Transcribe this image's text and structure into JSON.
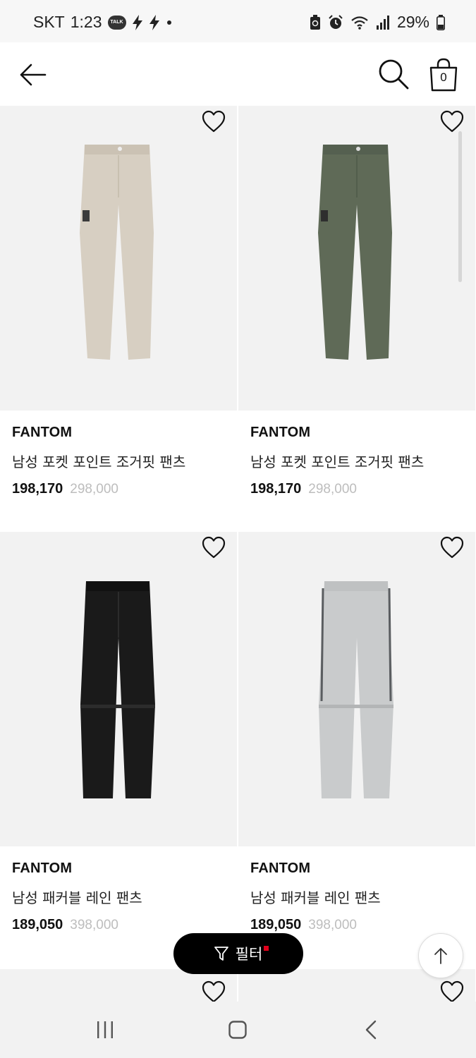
{
  "status_bar": {
    "carrier": "SKT",
    "time": "1:23",
    "talk_badge": "TALK",
    "battery_percent": "29%"
  },
  "header": {
    "cart_count": "0"
  },
  "products": [
    {
      "brand": "FANTOM",
      "name": "남성 포켓 포인트 조거핏 팬츠",
      "price": "198,170",
      "original_price": "298,000",
      "color": "#d7cfc2"
    },
    {
      "brand": "FANTOM",
      "name": "남성 포켓 포인트 조거핏 팬츠",
      "price": "198,170",
      "original_price": "298,000",
      "color": "#5f6a57"
    },
    {
      "brand": "FANTOM",
      "name": "남성 패커블 레인 팬츠",
      "price": "189,050",
      "original_price": "398,000",
      "color": "#1a1a1a"
    },
    {
      "brand": "FANTOM",
      "name": "남성 패커블 레인 팬츠",
      "price": "189,050",
      "original_price": "398,000",
      "color": "#c9cbcc"
    }
  ],
  "filter": {
    "label": "필터"
  },
  "colors": {
    "filter_bg": "#000000",
    "filter_dot": "#e1001b",
    "image_bg": "#f2f2f2",
    "original_price": "#bdbdbd"
  }
}
